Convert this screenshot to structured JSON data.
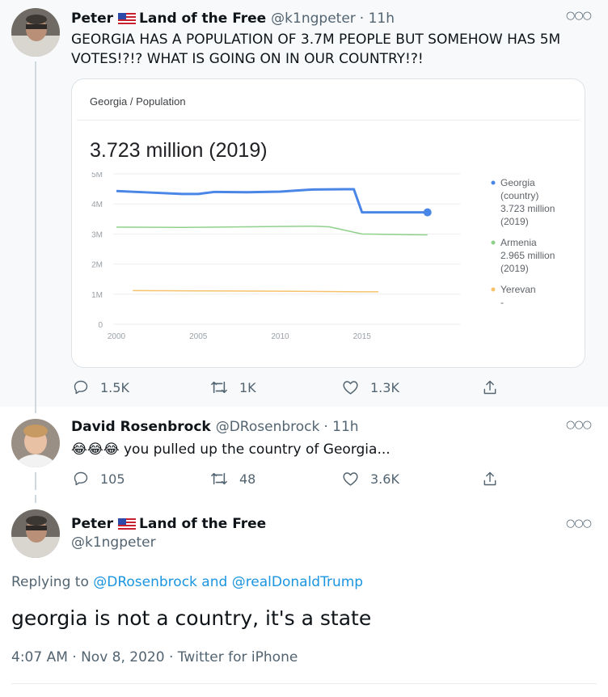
{
  "tweet1": {
    "name": "Peter",
    "flag_icon": "us-flag-icon",
    "name_suffix": "Land of the Free",
    "handle": "@k1ngpeter",
    "time": "· 11h",
    "text_line1": "GEORGIA HAS A POPULATION OF 3.7M PEOPLE BUT SOMEHOW HAS 5M",
    "text_line2": "VOTES!?!? WHAT IS GOING ON IN OUR COUNTRY!?!",
    "actions": {
      "replies": "1.5K",
      "retweets": "1K",
      "likes": "1.3K"
    }
  },
  "card": {
    "breadcrumb_1": "Georgia",
    "breadcrumb_sep": "/",
    "breadcrumb_2": "Population",
    "headline": "3.723 million (2019)"
  },
  "chart_data": {
    "type": "line",
    "title": "3.723 million (2019)",
    "x_ticks": [
      "2000",
      "2005",
      "2010",
      "2015"
    ],
    "y_ticks": [
      "0",
      "1M",
      "2M",
      "3M",
      "4M",
      "5M"
    ],
    "ylim": [
      0,
      5
    ],
    "xlim": [
      2000,
      2020
    ],
    "grid": true,
    "legend_placement": "right",
    "series": [
      {
        "name": "Georgia",
        "legend_lines": [
          "Georgia",
          "(country)",
          "3.723 million",
          "(2019)"
        ],
        "color": "#4a86e8",
        "x": [
          2000,
          2002,
          2004,
          2005,
          2006,
          2008,
          2010,
          2012,
          2014,
          2014.5,
          2015,
          2017,
          2019
        ],
        "y": [
          4.43,
          4.38,
          4.33,
          4.33,
          4.4,
          4.39,
          4.41,
          4.48,
          4.49,
          4.49,
          3.72,
          3.72,
          3.72
        ]
      },
      {
        "name": "Armenia",
        "legend_lines": [
          "Armenia",
          "2.965 million",
          "(2019)"
        ],
        "color": "#8fd18a",
        "x": [
          2000,
          2004,
          2008,
          2012,
          2013,
          2015,
          2019
        ],
        "y": [
          3.23,
          3.22,
          3.24,
          3.26,
          3.24,
          3.0,
          2.97
        ]
      },
      {
        "name": "Yerevan",
        "legend_lines": [
          "Yerevan",
          "-"
        ],
        "color": "#f6c26b",
        "x": [
          2001,
          2005,
          2010,
          2015,
          2016
        ],
        "y": [
          1.12,
          1.11,
          1.1,
          1.08,
          1.08
        ]
      }
    ]
  },
  "tweet2": {
    "name": "David Rosenbrock",
    "handle": "@DRosenbrock",
    "time": "· 11h",
    "emoji": "😂😂😂",
    "text": "you pulled up the country of Georgia...",
    "actions": {
      "replies": "105",
      "retweets": "48",
      "likes": "3.6K"
    }
  },
  "tweet3": {
    "name": "Peter",
    "name_suffix": "Land of the Free",
    "handle": "@k1ngpeter",
    "replying_label": "Replying to",
    "reply_user1": "@DRosenbrock",
    "reply_and": "and",
    "reply_user2": "@realDonaldTrump",
    "text": "georgia is not a country, it's a state",
    "timestamp": "4:07 AM · Nov 8, 2020 · Twitter for iPhone"
  }
}
